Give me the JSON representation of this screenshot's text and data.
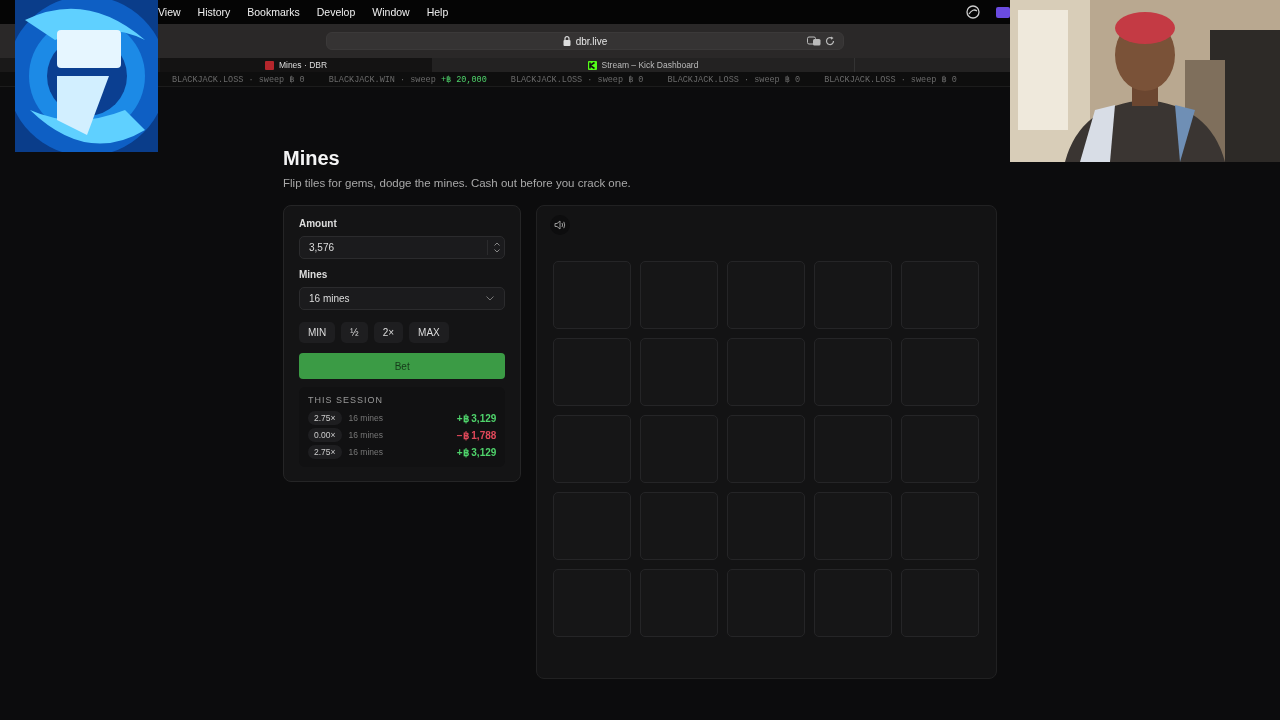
{
  "menu_bar": {
    "items": [
      "View",
      "History",
      "Bookmarks",
      "Develop",
      "Window",
      "Help"
    ]
  },
  "browser": {
    "address": "dbr.live",
    "tabs": [
      {
        "title": "Mines · DBR",
        "selected": true
      },
      {
        "title": "Stream – Kick Dashboard",
        "selected": false
      }
    ]
  },
  "ticker": [
    {
      "label": "BLACKJACK.LOSS · sweep",
      "amount": "฿ 0",
      "win": false
    },
    {
      "label": "BLACKJACK.WIN · sweep",
      "amount": "+฿ 20,000",
      "win": true
    },
    {
      "label": "BLACKJACK.LOSS · sweep",
      "amount": "฿ 0",
      "win": false
    },
    {
      "label": "BLACKJACK.LOSS · sweep",
      "amount": "฿ 0",
      "win": false
    },
    {
      "label": "BLACKJACK.LOSS · sweep",
      "amount": "฿ 0",
      "win": false
    }
  ],
  "page": {
    "title": "Mines",
    "subtitle": "Flip tiles for gems, dodge the mines. Cash out before you crack one."
  },
  "bet_panel": {
    "amount_label": "Amount",
    "amount": "3,576",
    "mines_label": "Mines",
    "mines": "16 mines",
    "quick_buttons": [
      "MIN",
      "½",
      "2×",
      "MAX"
    ],
    "bet_button": "Bet",
    "session": {
      "title": "THIS SESSION",
      "rows": [
        {
          "multiplier": "2.75×",
          "mines": "16 mines",
          "result": "+฿ 3,129",
          "win": true
        },
        {
          "multiplier": "0.00×",
          "mines": "16 mines",
          "result": "−฿ 1,788",
          "win": false
        },
        {
          "multiplier": "2.75×",
          "mines": "16 mines",
          "result": "+฿ 3,129",
          "win": true
        }
      ]
    }
  },
  "board": {
    "tiles": [
      {
        "revealed": false
      },
      {
        "revealed": false
      },
      {
        "revealed": false
      },
      {
        "revealed": false
      },
      {
        "revealed": false
      },
      {
        "revealed": false
      },
      {
        "revealed": false
      },
      {
        "revealed": false
      },
      {
        "revealed": false
      },
      {
        "revealed": false
      },
      {
        "revealed": false
      },
      {
        "revealed": false
      },
      {
        "revealed": false
      },
      {
        "revealed": false
      },
      {
        "revealed": false
      },
      {
        "revealed": false
      },
      {
        "revealed": false
      },
      {
        "revealed": false
      },
      {
        "revealed": false
      },
      {
        "revealed": false
      },
      {
        "revealed": false
      },
      {
        "revealed": false
      },
      {
        "revealed": false
      },
      {
        "revealed": false
      },
      {
        "revealed": false
      }
    ]
  }
}
